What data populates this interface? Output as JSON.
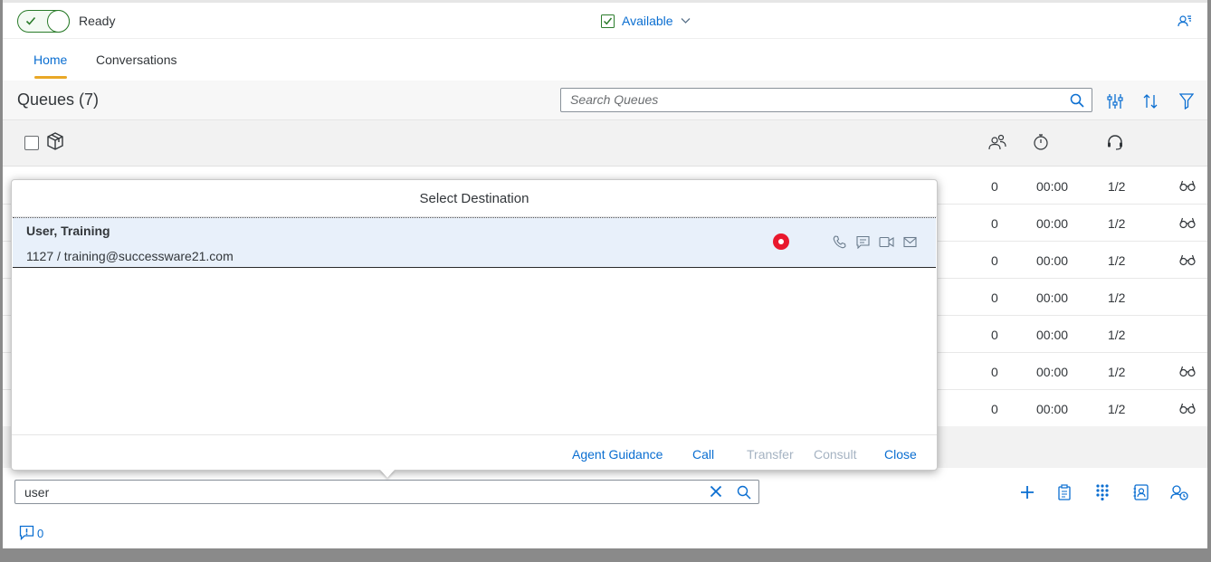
{
  "topbar": {
    "status_toggle": "on",
    "status_label": "Ready",
    "availability_label": "Available"
  },
  "tabs": [
    {
      "label": "Home",
      "active": true
    },
    {
      "label": "Conversations",
      "active": false
    }
  ],
  "queues": {
    "title": "Queues (7)",
    "search_placeholder": "Search Queues",
    "rows": [
      {
        "count": "0",
        "time": "00:00",
        "ratio": "1/2",
        "watch": true
      },
      {
        "count": "0",
        "time": "00:00",
        "ratio": "1/2",
        "watch": true
      },
      {
        "count": "0",
        "time": "00:00",
        "ratio": "1/2",
        "watch": true
      },
      {
        "count": "0",
        "time": "00:00",
        "ratio": "1/2",
        "watch": false
      },
      {
        "count": "0",
        "time": "00:00",
        "ratio": "1/2",
        "watch": false
      },
      {
        "count": "0",
        "time": "00:00",
        "ratio": "1/2",
        "watch": true
      },
      {
        "count": "0",
        "time": "00:00",
        "ratio": "1/2",
        "watch": true
      }
    ]
  },
  "popover": {
    "title": "Select Destination",
    "item": {
      "name": "User, Training",
      "detail": "1127 / training@successware21.com",
      "presence_color": "#e9182d"
    },
    "buttons": {
      "agent_guidance": "Agent Guidance",
      "call": "Call",
      "transfer": "Transfer",
      "consult": "Consult",
      "close": "Close"
    }
  },
  "footer": {
    "destination_value": "user",
    "notification_count": "0"
  },
  "colors": {
    "accent": "#0a6ed1",
    "ready_green": "#2b7c2b",
    "tab_underline": "#e9a827",
    "disabled": "#a5b3c2"
  }
}
